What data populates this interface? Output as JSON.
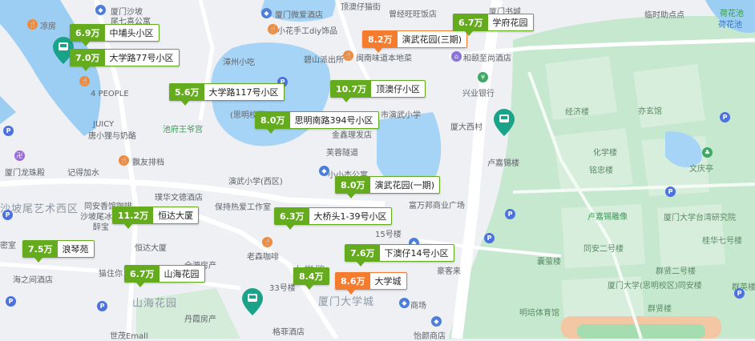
{
  "listings": [
    {
      "price": "6.9万",
      "name": "中埔头小区",
      "highlight": false
    },
    {
      "price": "7.0万",
      "name": "大学路77号小区",
      "highlight": false
    },
    {
      "price": "8.2万",
      "name": "演武花园(三期)",
      "highlight": true
    },
    {
      "price": "6.7万",
      "name": "学府花园",
      "highlight": false
    },
    {
      "price": "5.6万",
      "name": "大学路117号小区",
      "highlight": false
    },
    {
      "price": "10.7万",
      "name": "顶澳仔小区",
      "highlight": false
    },
    {
      "price": "8.0万",
      "name": "思明南路394号小区",
      "highlight": false
    },
    {
      "price": "8.0万",
      "name": "演武花园(一期)",
      "highlight": false
    },
    {
      "price": "11.2万",
      "name": "恒达大厦",
      "highlight": false
    },
    {
      "price": "6.3万",
      "name": "大桥头1-39号小区",
      "highlight": false
    },
    {
      "price": "7.5万",
      "name": "浪琴苑",
      "highlight": false
    },
    {
      "price": "7.6万",
      "name": "下澳仔14号小区",
      "highlight": false
    },
    {
      "price": "6.7万",
      "name": "山海花园",
      "highlight": false
    },
    {
      "price": "8.4万",
      "name": "",
      "highlight": false
    },
    {
      "price": "8.6万",
      "name": "大学城",
      "highlight": true
    }
  ],
  "places": [
    "凉房",
    "厦门沙坡",
    "尾七喜公寓",
    "厦门微爱酒店",
    "顶澳仔猫街",
    "曾经旺旺饭店",
    "厦门书城",
    "临时助点点",
    "荷花池",
    "荷花池",
    "小花手工diy饰品",
    "碧山派出所",
    "闽南味道本地菜",
    "和颐至尚酒店",
    "漳州小吃",
    "兴业银行",
    "经济楼",
    "亦玄馆",
    "4 PEOPLE",
    "(思明校区)",
    "市演武小学",
    "厦大西村",
    "池府王爷宫",
    "JUICY",
    "唐小狸与奶酪",
    "金鑫理发店",
    "化学楼",
    "飘友排档",
    "芙蓉隧道",
    "文庆亭",
    "厦门龙珠殿",
    "记得加水",
    "演武小学(西区)",
    "小小杰公寓",
    "卢嘉锡楼",
    "铭忠楼",
    "璞华文德酒店",
    "同安香馆咖啡",
    "富万邦商业广场",
    "卢嘉锡雕像",
    "厦门大学台湾研究院",
    "桂华七号楼",
    "沙坡尾艺术西区",
    "保持热爱工作室",
    "沙坡尾冰淇淋",
    "醉宝",
    "恒达大厦",
    "15号楼",
    "同安二号楼",
    "密室",
    "老森咖啡",
    "豪客来",
    "大学路",
    "囊萤楼",
    "群贤二号楼",
    "猫住你",
    "全源房产",
    "厦门大学(思明校区)同安楼",
    "群英楼",
    "海之间酒店",
    "33号楼",
    "厦门大学城",
    "商场",
    "明培体育馆",
    "群贤楼",
    "山海花园",
    "丹霞房产",
    "格菲酒店",
    "怡颜商店",
    "世茂Emall"
  ]
}
